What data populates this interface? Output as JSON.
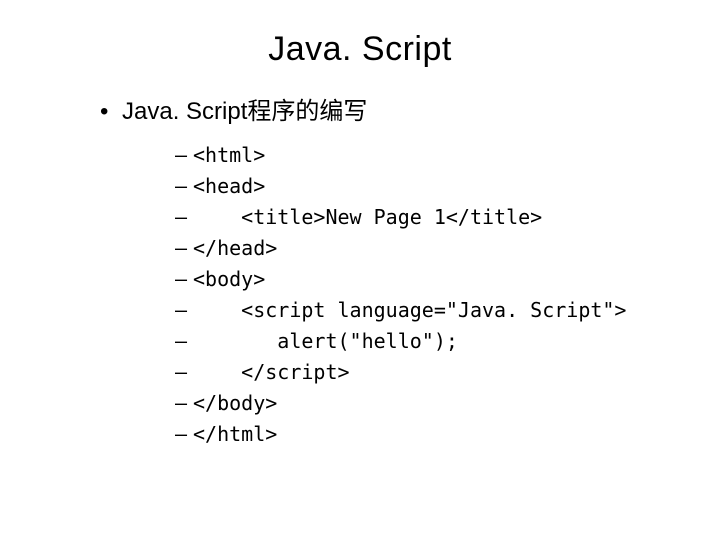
{
  "title": "Java. Script",
  "bullet": "Java. Script程序的编写",
  "code": {
    "l1": "<html>",
    "l2": "<head>",
    "l3": "    <title>New Page 1</title>",
    "l4": "</head>",
    "l5": "<body>",
    "l6": "    <script language=\"Java. Script\">",
    "l7": "       alert(\"hello\");",
    "l8": "    </script>",
    "l9": "</body>",
    "l10": "</html>"
  }
}
